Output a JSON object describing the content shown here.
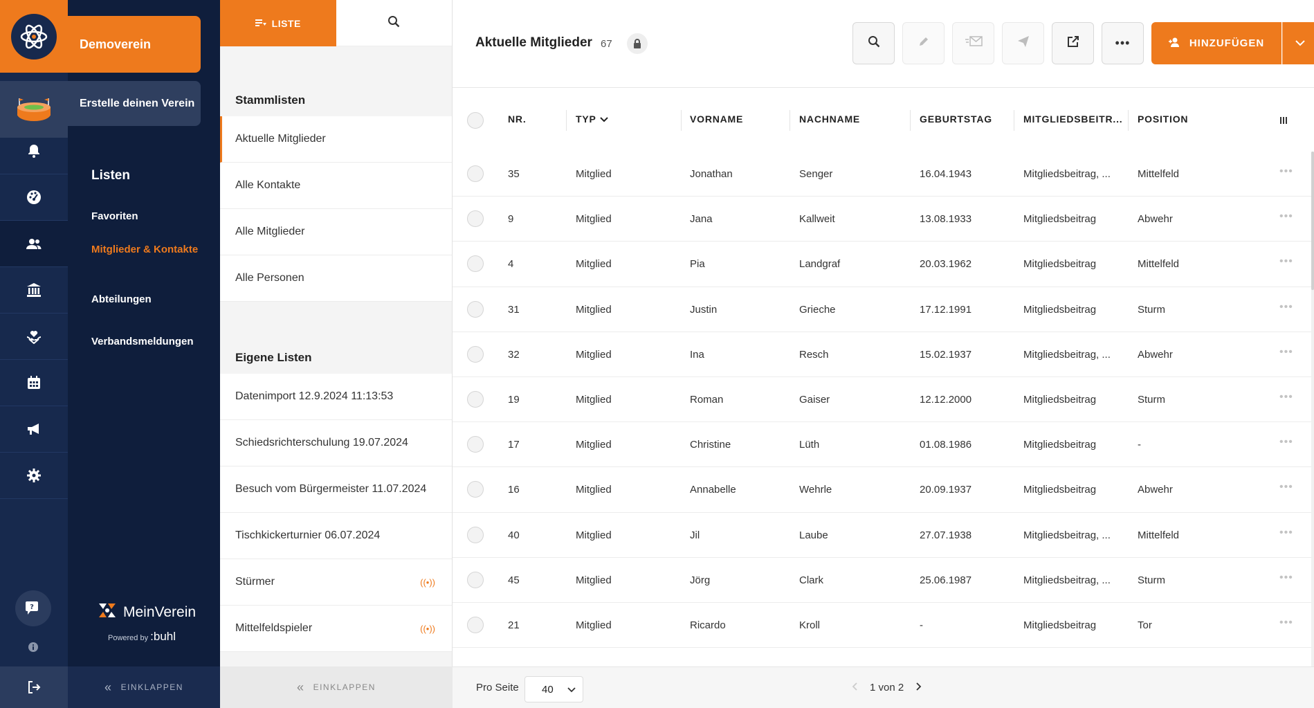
{
  "sidebar": {
    "club_name": "Demoverein",
    "create_club": "Erstelle deinen Verein",
    "rail_icons": [
      "bell-icon",
      "dashboard-icon",
      "members-icon",
      "bank-icon",
      "donation-icon",
      "calendar-icon",
      "megaphone-icon",
      "gear-icon"
    ],
    "section_title": "Listen",
    "items": [
      {
        "label": "Favoriten"
      },
      {
        "label": "Mitglieder & Kontakte"
      },
      {
        "label": "Abteilungen"
      },
      {
        "label": "Verbandsmeldungen"
      }
    ],
    "brand": "MeinVerein",
    "powered_by": "Powered by",
    "powered_brand": ":buhl",
    "collapse": "EINKLAPPEN"
  },
  "lists": {
    "tab_liste": "LISTE",
    "section_master": "Stammlisten",
    "master": [
      "Aktuelle Mitglieder",
      "Alle Kontakte",
      "Alle Mitglieder",
      "Alle Personen"
    ],
    "section_own": "Eigene Listen",
    "own": [
      "Datenimport 12.9.2024 11:13:53",
      "Schiedsrichterschulung 19.07.2024",
      "Besuch vom Bürgermeister 11.07.2024",
      "Tischkickerturnier 06.07.2024",
      "Stürmer",
      "Mittelfeldspieler"
    ],
    "collapse": "EINKLAPPEN"
  },
  "main": {
    "title": "Aktuelle Mitglieder",
    "count": "67",
    "add_label": "HINZUFÜGEN",
    "columns": {
      "nr": "NR.",
      "typ": "TYP",
      "vorname": "VORNAME",
      "nachname": "NACHNAME",
      "geburtstag": "GEBURTSTAG",
      "beitrag": "MITGLIEDSBEITR...",
      "position": "POSITION"
    },
    "rows": [
      [
        "35",
        "Mitglied",
        "Jonathan",
        "Senger",
        "16.04.1943",
        "Mitgliedsbeitrag, ...",
        "Mittelfeld"
      ],
      [
        "9",
        "Mitglied",
        "Jana",
        "Kallweit",
        "13.08.1933",
        "Mitgliedsbeitrag",
        "Abwehr"
      ],
      [
        "4",
        "Mitglied",
        "Pia",
        "Landgraf",
        "20.03.1962",
        "Mitgliedsbeitrag",
        "Mittelfeld"
      ],
      [
        "31",
        "Mitglied",
        "Justin",
        "Grieche",
        "17.12.1991",
        "Mitgliedsbeitrag",
        "Sturm"
      ],
      [
        "32",
        "Mitglied",
        "Ina",
        "Resch",
        "15.02.1937",
        "Mitgliedsbeitrag, ...",
        "Abwehr"
      ],
      [
        "19",
        "Mitglied",
        "Roman",
        "Gaiser",
        "12.12.2000",
        "Mitgliedsbeitrag",
        "Sturm"
      ],
      [
        "17",
        "Mitglied",
        "Christine",
        "Lüth",
        "01.08.1986",
        "Mitgliedsbeitrag",
        "-"
      ],
      [
        "16",
        "Mitglied",
        "Annabelle",
        "Wehrle",
        "20.09.1937",
        "Mitgliedsbeitrag",
        "Abwehr"
      ],
      [
        "40",
        "Mitglied",
        "Jil",
        "Laube",
        "27.07.1938",
        "Mitgliedsbeitrag, ...",
        "Mittelfeld"
      ],
      [
        "45",
        "Mitglied",
        "Jörg",
        "Clark",
        "25.06.1987",
        "Mitgliedsbeitrag, ...",
        "Sturm"
      ],
      [
        "21",
        "Mitglied",
        "Ricardo",
        "Kroll",
        "-",
        "Mitgliedsbeitrag",
        "Tor"
      ]
    ],
    "per_page_label": "Pro Seite",
    "per_page_value": "40",
    "pagination": "1 von 2"
  },
  "colors": {
    "accent": "#ee7a1d",
    "rail": "#17294d",
    "nav": "#0f1e3c"
  }
}
